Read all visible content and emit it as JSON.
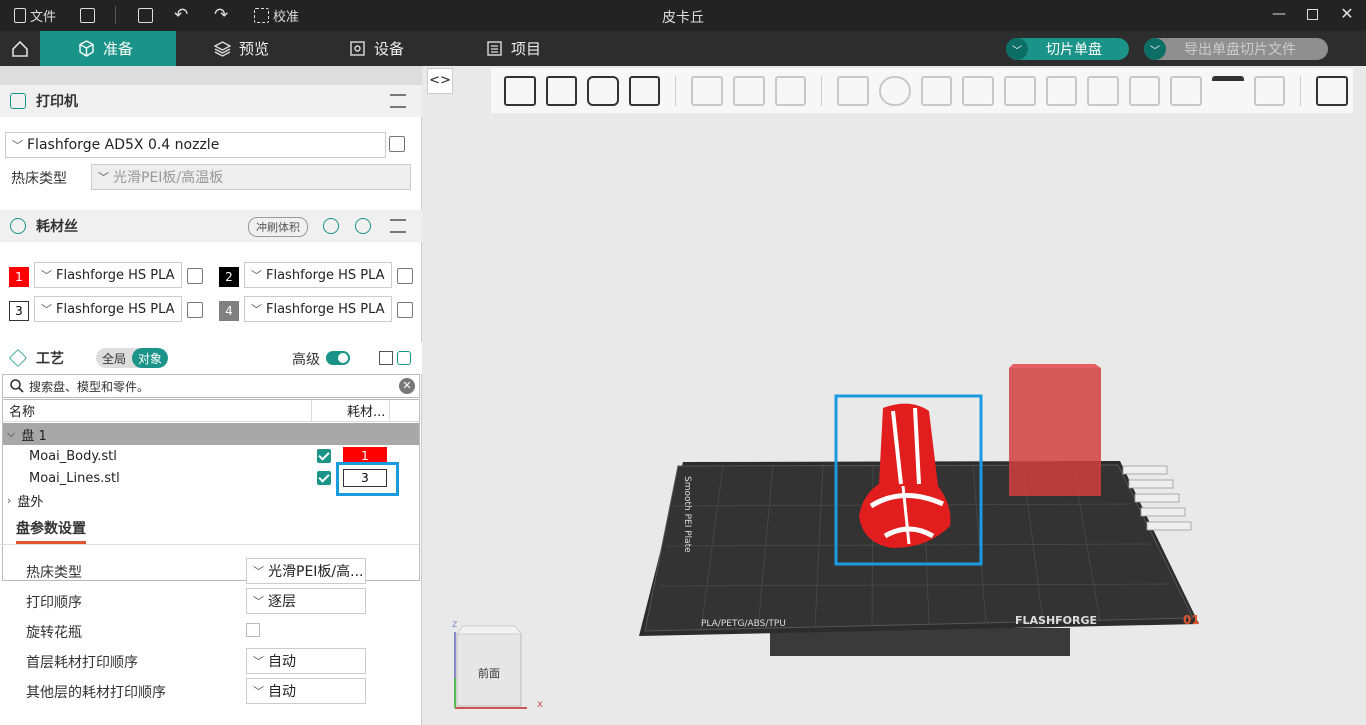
{
  "title": "皮卡丘",
  "menu": {
    "file_label": "文件",
    "calibrate_label": "校准"
  },
  "nav": {
    "tabs": [
      {
        "label": "准备"
      },
      {
        "label": "预览"
      },
      {
        "label": "设备"
      },
      {
        "label": "项目"
      }
    ],
    "slice_label": "切片单盘",
    "export_label": "导出单盘切片文件"
  },
  "printer": {
    "section_title": "打印机",
    "selected": "Flashforge AD5X 0.4 nozzle",
    "bed_type_label": "热床类型",
    "bed_type_value": "光滑PEI板/高温板"
  },
  "filament": {
    "section_title": "耗材丝",
    "flush_label": "冲刷体积",
    "slots": [
      {
        "num": "1",
        "name": "Flashforge HS PLA",
        "color": "#ff0000"
      },
      {
        "num": "2",
        "name": "Flashforge HS PLA",
        "color": "#000000"
      },
      {
        "num": "3",
        "name": "Flashforge HS PLA",
        "color": "#ffffff"
      },
      {
        "num": "4",
        "name": "Flashforge HS PLA",
        "color": "#808080"
      }
    ]
  },
  "process": {
    "section_title": "工艺",
    "global_label": "全局",
    "object_label": "对象",
    "advanced_label": "高级"
  },
  "search": {
    "placeholder": "搜索盘、模型和零件。"
  },
  "objects": {
    "col_name": "名称",
    "col_filament": "耗材...",
    "plate_label": "盘 1",
    "items": [
      {
        "name": "Moai_Body.stl",
        "filament": "1"
      },
      {
        "name": "Moai_Lines.stl",
        "filament": "3"
      }
    ],
    "outside_label": "盘外"
  },
  "plate_params": {
    "tab_label": "盘参数设置",
    "rows": [
      {
        "label": "热床类型",
        "value": "光滑PEI板/高..."
      },
      {
        "label": "打印顺序",
        "value": "逐层"
      },
      {
        "label": "旋转花瓶",
        "value": ""
      },
      {
        "label": "首层耗材打印顺序",
        "value": "自动"
      },
      {
        "label": "其他层的耗材打印顺序",
        "value": "自动"
      }
    ]
  },
  "viewport": {
    "plate_brand": "FLASHFORGE",
    "plate_materials": "PLA/PETG/ABS/TPU",
    "plate_side_text": "Smooth PEI Plate",
    "plate_number": "01",
    "view_cube_front": "前面",
    "axis_x": "x",
    "axis_z": "z",
    "accent_color": "#1a9488",
    "selection_color": "#1a9be0"
  }
}
